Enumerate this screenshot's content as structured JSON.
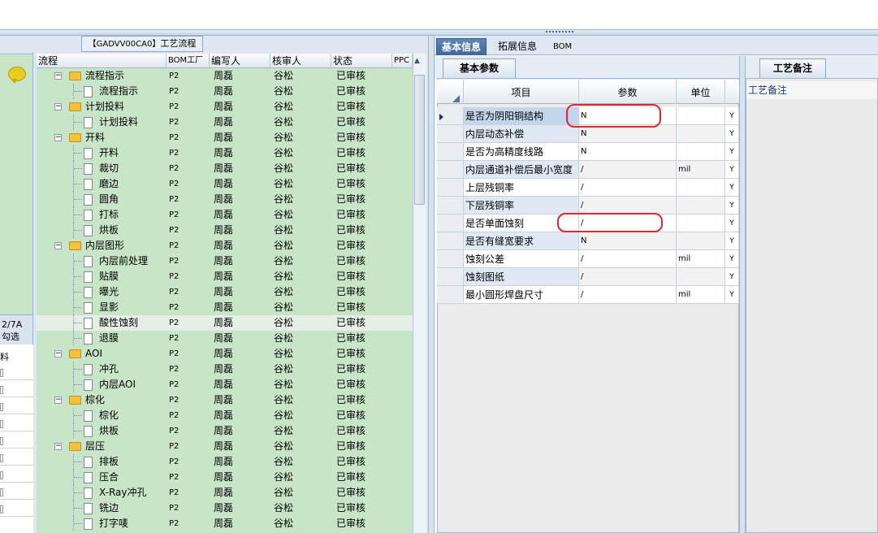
{
  "left_panel": {
    "count_label": "2/7A",
    "check_label": "勾选",
    "column_label": "料"
  },
  "flow_panel": {
    "title_code": "【GADVV00CA0】",
    "title_text": "工艺流程",
    "columns": [
      "流程",
      "BOM工厂",
      "编写人",
      "核审人",
      "状态",
      "PPC"
    ],
    "rows": [
      {
        "name": "流程指示",
        "type": "folder",
        "level": 1,
        "bom": "P2",
        "writer": "周磊",
        "reviewer": "谷松",
        "status": "已审核"
      },
      {
        "name": "流程指示",
        "type": "doc",
        "level": 2,
        "bom": "P2",
        "writer": "周磊",
        "reviewer": "谷松",
        "status": "已审核"
      },
      {
        "name": "计划投料",
        "type": "folder",
        "level": 1,
        "bom": "P2",
        "writer": "周磊",
        "reviewer": "谷松",
        "status": "已审核"
      },
      {
        "name": "计划投料",
        "type": "doc",
        "level": 2,
        "bom": "P2",
        "writer": "周磊",
        "reviewer": "谷松",
        "status": "已审核"
      },
      {
        "name": "开料",
        "type": "folder",
        "level": 1,
        "bom": "P2",
        "writer": "周磊",
        "reviewer": "谷松",
        "status": "已审核"
      },
      {
        "name": "开料",
        "type": "doc",
        "level": 2,
        "bom": "P2",
        "writer": "周磊",
        "reviewer": "谷松",
        "status": "已审核"
      },
      {
        "name": "裁切",
        "type": "doc",
        "level": 2,
        "bom": "P2",
        "writer": "周磊",
        "reviewer": "谷松",
        "status": "已审核"
      },
      {
        "name": "磨边",
        "type": "doc",
        "level": 2,
        "bom": "P2",
        "writer": "周磊",
        "reviewer": "谷松",
        "status": "已审核"
      },
      {
        "name": "圆角",
        "type": "doc",
        "level": 2,
        "bom": "P2",
        "writer": "周磊",
        "reviewer": "谷松",
        "status": "已审核"
      },
      {
        "name": "打标",
        "type": "doc",
        "level": 2,
        "bom": "P2",
        "writer": "周磊",
        "reviewer": "谷松",
        "status": "已审核"
      },
      {
        "name": "烘板",
        "type": "doc",
        "level": 2,
        "bom": "P2",
        "writer": "周磊",
        "reviewer": "谷松",
        "status": "已审核"
      },
      {
        "name": "内层图形",
        "type": "folder",
        "level": 1,
        "bom": "P2",
        "writer": "周磊",
        "reviewer": "谷松",
        "status": "已审核"
      },
      {
        "name": "内层前处理",
        "type": "doc",
        "level": 2,
        "bom": "P2",
        "writer": "周磊",
        "reviewer": "谷松",
        "status": "已审核"
      },
      {
        "name": "贴膜",
        "type": "doc",
        "level": 2,
        "bom": "P2",
        "writer": "周磊",
        "reviewer": "谷松",
        "status": "已审核"
      },
      {
        "name": "曝光",
        "type": "doc",
        "level": 2,
        "bom": "P2",
        "writer": "周磊",
        "reviewer": "谷松",
        "status": "已审核"
      },
      {
        "name": "显影",
        "type": "doc",
        "level": 2,
        "bom": "P2",
        "writer": "周磊",
        "reviewer": "谷松",
        "status": "已审核"
      },
      {
        "name": "酸性蚀刻",
        "type": "doc",
        "level": 2,
        "bom": "P2",
        "writer": "周磊",
        "reviewer": "谷松",
        "status": "已审核",
        "selected": true
      },
      {
        "name": "退膜",
        "type": "doc",
        "level": 2,
        "bom": "P2",
        "writer": "周磊",
        "reviewer": "谷松",
        "status": "已审核"
      },
      {
        "name": "AOI",
        "type": "folder",
        "level": 1,
        "bom": "P2",
        "writer": "周磊",
        "reviewer": "谷松",
        "status": "已审核"
      },
      {
        "name": "冲孔",
        "type": "doc",
        "level": 2,
        "bom": "P2",
        "writer": "周磊",
        "reviewer": "谷松",
        "status": "已审核"
      },
      {
        "name": "内层AOI",
        "type": "doc",
        "level": 2,
        "bom": "P2",
        "writer": "周磊",
        "reviewer": "谷松",
        "status": "已审核"
      },
      {
        "name": "棕化",
        "type": "folder",
        "level": 1,
        "bom": "P2",
        "writer": "周磊",
        "reviewer": "谷松",
        "status": "已审核"
      },
      {
        "name": "棕化",
        "type": "doc",
        "level": 2,
        "bom": "P2",
        "writer": "周磊",
        "reviewer": "谷松",
        "status": "已审核"
      },
      {
        "name": "烘板",
        "type": "doc",
        "level": 2,
        "bom": "P2",
        "writer": "周磊",
        "reviewer": "谷松",
        "status": "已审核"
      },
      {
        "name": "层压",
        "type": "folder",
        "level": 1,
        "bom": "P2",
        "writer": "周磊",
        "reviewer": "谷松",
        "status": "已审核"
      },
      {
        "name": "排板",
        "type": "doc",
        "level": 2,
        "bom": "P2",
        "writer": "周磊",
        "reviewer": "谷松",
        "status": "已审核"
      },
      {
        "name": "压合",
        "type": "doc",
        "level": 2,
        "bom": "P2",
        "writer": "周磊",
        "reviewer": "谷松",
        "status": "已审核"
      },
      {
        "name": "X-Ray冲孔",
        "type": "doc",
        "level": 2,
        "bom": "P2",
        "writer": "周磊",
        "reviewer": "谷松",
        "status": "已审核"
      },
      {
        "name": "铣边",
        "type": "doc",
        "level": 2,
        "bom": "P2",
        "writer": "周磊",
        "reviewer": "谷松",
        "status": "已审核"
      },
      {
        "name": "打字唛",
        "type": "doc",
        "level": 2,
        "bom": "P2",
        "writer": "周磊",
        "reviewer": "谷松",
        "status": "已审核"
      }
    ]
  },
  "right_panel": {
    "tabs": [
      "基本信息",
      "拓展信息",
      "BOM"
    ],
    "sub_tab": "基本参数",
    "columns": [
      "项目",
      "参数",
      "单位"
    ],
    "rows": [
      {
        "item": "是否为阴阳铜结构",
        "value": "N",
        "unit": "",
        "flag": "Y"
      },
      {
        "item": "内层动态补偿",
        "value": "N",
        "unit": "",
        "flag": "Y"
      },
      {
        "item": "是否为高精度线路",
        "value": "N",
        "unit": "",
        "flag": "Y"
      },
      {
        "item": "内层通道补偿后最小宽度",
        "value": "/",
        "unit": "mil",
        "flag": "Y"
      },
      {
        "item": "上层残铜率",
        "value": "/",
        "unit": "",
        "flag": "Y"
      },
      {
        "item": "下层残铜率",
        "value": "/",
        "unit": "",
        "flag": "Y"
      },
      {
        "item": "是否单面蚀刻",
        "value": "/",
        "unit": "",
        "flag": "Y"
      },
      {
        "item": "是否有缝宽要求",
        "value": "N",
        "unit": "",
        "flag": "Y"
      },
      {
        "item": "蚀刻公差",
        "value": "/",
        "unit": "mil",
        "flag": "Y"
      },
      {
        "item": "蚀刻图纸",
        "value": "/",
        "unit": "",
        "flag": "Y"
      },
      {
        "item": "最小圆形焊盘尺寸",
        "value": "/",
        "unit": "mil",
        "flag": "Y"
      }
    ]
  },
  "notes_panel": {
    "tab": "工艺备注",
    "label": "工艺备注"
  },
  "colors": {
    "tree_bg": "#c9e5c7",
    "highlight_oval": "#e0282c",
    "active_tab": "#3d679e"
  }
}
